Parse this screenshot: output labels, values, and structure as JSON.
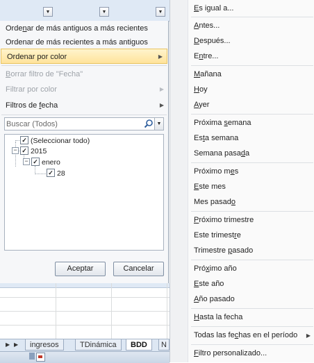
{
  "menu": {
    "sort_oldest": {
      "pre": "Orde",
      "u": "n",
      "post": "ar de más antiguos a más recientes"
    },
    "sort_newest": {
      "pre": "Ordenar de más recientes a más antiguos",
      "u": "",
      "post": ""
    },
    "sort_color": {
      "pre": "Ordenar por color",
      "u": "",
      "post": ""
    },
    "clear_filter": {
      "pre": "",
      "u": "B",
      "post": "orrar filtro de \"Fecha\""
    },
    "filter_color": {
      "pre": "Filtrar por color",
      "u": "",
      "post": ""
    },
    "date_filters": {
      "pre": "Filtros de ",
      "u": "f",
      "post": "echa"
    },
    "arrow": "▶"
  },
  "search": {
    "placeholder": "Buscar (Todos)",
    "icon": "magnifier-icon"
  },
  "tree": {
    "select_all": "(Seleccionar todo)",
    "year": "2015",
    "month": "enero",
    "day": "28",
    "toggle_expanded": "−"
  },
  "buttons": {
    "accept": "Aceptar",
    "cancel": "Cancelar"
  },
  "sheet": {
    "tabs": [
      "ingresos",
      "TDinámica",
      "BDD",
      "N"
    ],
    "active_tab": "BDD",
    "nav_arrows": [
      "◀",
      "▶"
    ]
  },
  "date_filter_submenu": {
    "items": [
      {
        "pre": "",
        "u": "E",
        "post": "s igual a..."
      },
      {
        "pre": "",
        "u": "A",
        "post": "ntes..."
      },
      {
        "pre": "",
        "u": "D",
        "post": "espués..."
      },
      {
        "pre": "E",
        "u": "n",
        "post": "tre..."
      },
      {
        "pre": "",
        "u": "M",
        "post": "añana"
      },
      {
        "pre": "",
        "u": "H",
        "post": "oy"
      },
      {
        "pre": "",
        "u": "A",
        "post": "yer"
      },
      {
        "pre": "Próxima ",
        "u": "s",
        "post": "emana"
      },
      {
        "pre": "Es",
        "u": "t",
        "post": "a semana"
      },
      {
        "pre": "Semana pasa",
        "u": "d",
        "post": "a"
      },
      {
        "pre": "Próximo m",
        "u": "e",
        "post": "s"
      },
      {
        "pre": "",
        "u": "E",
        "post": "ste mes"
      },
      {
        "pre": "Mes pasad",
        "u": "o",
        "post": ""
      },
      {
        "pre": "",
        "u": "P",
        "post": "róximo trimestre"
      },
      {
        "pre": "Este trimest",
        "u": "r",
        "post": "e"
      },
      {
        "pre": "Trimestre ",
        "u": "p",
        "post": "asado"
      },
      {
        "pre": "Pró",
        "u": "x",
        "post": "imo año"
      },
      {
        "pre": "",
        "u": "E",
        "post": "ste año"
      },
      {
        "pre": "",
        "u": "A",
        "post": "ño pasado"
      },
      {
        "pre": "",
        "u": "H",
        "post": "asta la fecha"
      },
      {
        "pre": "Todas las fe",
        "u": "c",
        "post": "has en el período"
      },
      {
        "pre": "",
        "u": "F",
        "post": "iltro personalizado..."
      }
    ],
    "submenu_arrow": "▶"
  },
  "colors": {
    "highlight": "#ffe39b",
    "sheet_header": "#dfe9f5"
  }
}
